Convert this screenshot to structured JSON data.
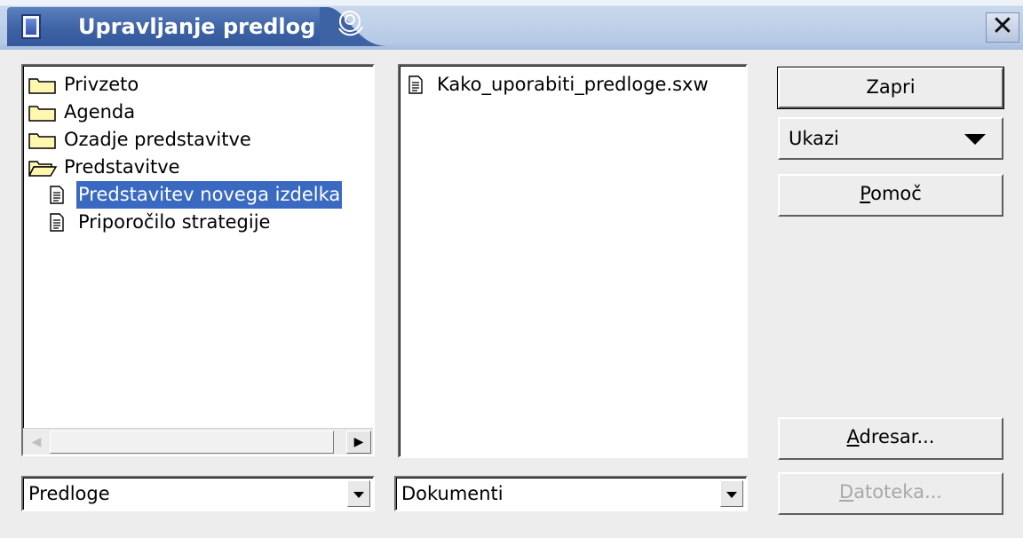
{
  "window": {
    "title": "Upravljanje predlog",
    "close_glyph": "✕"
  },
  "tree": {
    "items": [
      {
        "label": "Privzeto",
        "icon": "folder-icon"
      },
      {
        "label": "Agenda",
        "icon": "folder-icon"
      },
      {
        "label": "Ozadje predstavitve",
        "icon": "folder-icon"
      },
      {
        "label": "Predstavitve",
        "icon": "folder-open-icon"
      },
      {
        "label": "Predstavitev novega izdelka",
        "icon": "document-icon",
        "selected": true
      },
      {
        "label": "Priporočilo strategije",
        "icon": "document-icon"
      }
    ],
    "scroll_right_glyph": "▶",
    "scroll_left_glyph": "◀"
  },
  "files": {
    "items": [
      {
        "label": "Kako_uporabiti_predloge.sxw",
        "icon": "document-icon"
      }
    ]
  },
  "left_combo": {
    "value": "Predloge"
  },
  "right_combo": {
    "value": "Dokumenti"
  },
  "buttons": {
    "close": "Zapri",
    "show": "Ukazi",
    "help_mnemonic": "P",
    "help_rest": "omoč",
    "addressbook_mnemonic": "A",
    "addressbook_rest": "dresar...",
    "file_mnemonic": "D",
    "file_rest": "atoteka..."
  },
  "colors": {
    "selection": "#3a69c1",
    "title_tab": "#3d63a5"
  }
}
